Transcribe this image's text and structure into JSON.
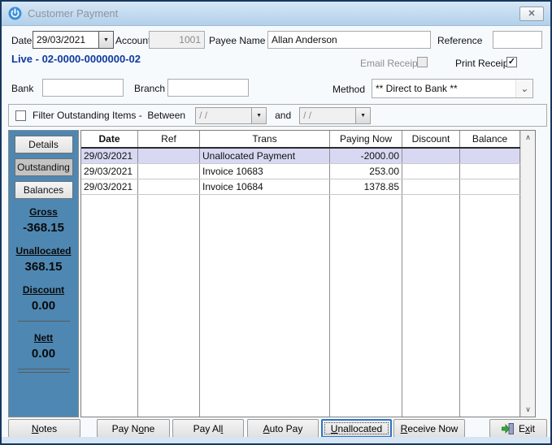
{
  "window": {
    "title": "Customer Payment"
  },
  "icons": {
    "dropdown": "▼",
    "chevron": "⌄",
    "check": "✓",
    "close": "✕",
    "scroll_up": "∧",
    "scroll_down": "∨"
  },
  "colors": {
    "titlebar": "#BFD8ED",
    "window_border": "#17375E",
    "sidebar": "#4E87B2",
    "selected_row": "#D8D8F3",
    "live_text": "#10399E",
    "focus_border": "#2F73C4"
  },
  "header": {
    "date_label": "Date",
    "date_value": "29/03/2021",
    "account_label": "Account",
    "account_value": "1001",
    "payee_label": "Payee Name",
    "payee_value": "Allan Anderson",
    "reference_label": "Reference",
    "reference_value": "",
    "live_line": "Live - 02-0000-0000000-02",
    "email_receipt_label": "Email Receipt",
    "print_receipt_label": "Print Receipt",
    "bank_label": "Bank",
    "bank_value": "",
    "branch_label": "Branch",
    "branch_value": "",
    "method_label": "Method",
    "method_value": "** Direct to Bank **"
  },
  "filter": {
    "label": "Filter Outstanding Items -  Between",
    "from_value": "/ /",
    "and_label": "and",
    "to_value": "/ /"
  },
  "sidebar": {
    "tabs": [
      {
        "label": "Details"
      },
      {
        "label": "Outstanding"
      },
      {
        "label": "Balances"
      }
    ],
    "totals": [
      {
        "label": "Gross",
        "value": "-368.15"
      },
      {
        "label": "Unallocated",
        "value": "368.15"
      },
      {
        "label": "Discount",
        "value": "0.00"
      },
      {
        "label": "Nett",
        "value": "0.00"
      }
    ]
  },
  "table": {
    "columns": [
      "Date",
      "Ref",
      "Trans",
      "Paying Now",
      "Discount",
      "Balance"
    ],
    "rows": [
      {
        "date": "29/03/2021",
        "ref": "",
        "trans": "Unallocated Payment",
        "paying_now": "-2000.00",
        "discount": "",
        "balance": ""
      },
      {
        "date": "29/03/2021",
        "ref": "",
        "trans": "Invoice 10683",
        "paying_now": "253.00",
        "discount": "",
        "balance": ""
      },
      {
        "date": "29/03/2021",
        "ref": "",
        "trans": "Invoice 10684",
        "paying_now": "1378.85",
        "discount": "",
        "balance": ""
      }
    ]
  },
  "footer": {
    "notes": {
      "pre": "",
      "key": "N",
      "post": "otes"
    },
    "pay_none": {
      "pre": "Pay N",
      "key": "o",
      "post": "ne"
    },
    "pay_all": {
      "pre": "Pay Al",
      "key": "l",
      "post": ""
    },
    "auto_pay": {
      "pre": "",
      "key": "A",
      "post": "uto Pay"
    },
    "unallocated": {
      "pre": "",
      "key": "U",
      "post": "nallocated"
    },
    "receive_now": {
      "pre": "",
      "key": "R",
      "post": "eceive Now"
    },
    "exit": {
      "pre": "E",
      "key": "x",
      "post": "it"
    }
  }
}
